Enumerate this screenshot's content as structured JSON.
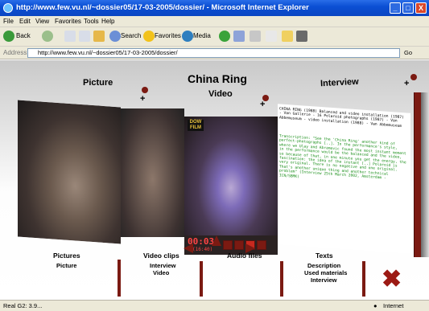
{
  "window": {
    "title": "http://www.few.vu.nl/~dossier05/17-03-2005/dossier/ - Microsoft Internet Explorer",
    "controls": {
      "minimize": "_",
      "maximize": "□",
      "close": "X"
    }
  },
  "menu": [
    "File",
    "Edit",
    "View",
    "Favorites",
    "Tools",
    "Help"
  ],
  "toolbar": {
    "back": "Back",
    "search": "Search",
    "favorites": "Favorites",
    "media": "Media"
  },
  "address": {
    "label": "Address",
    "url": "http://www.few.vu.nl/~dossier05/17-03-2005/dossier/",
    "go": "Go"
  },
  "page": {
    "title": "China Ring",
    "headings": {
      "picture": "Picture",
      "video": "Video",
      "interview": "Interview"
    },
    "plus": "+",
    "video_logo_top": "DOW",
    "video_logo_bottom": "FILM",
    "timecode": "00:03",
    "duration": "(16:40)",
    "text_red": "CHINA RING (1988) Balanced and video installation (1987) - Van Gallerie - 16 Polaroid photographs (1987) - Van Abbemuseum - video installation (1988) - Van Abbemuseum",
    "text_green": "Transcription: \"See the 'China Ring' another kind of perfect-photographs [..]. In the performance's style, where we Ulay and Abramovic found the most instant moment in the performance would be the balanced and the video, so because of that, in one minute you get the energy, the fascination: the idea of the instant [..] Polaroid is very original. There is no negative and one original. That's another unique thing and another technical problem\" (Interview 25th March 2002, Amsterdam - ICN/SBMK)"
  },
  "bottom_nav": {
    "pictures": {
      "heading": "Pictures",
      "items": [
        "Picture"
      ]
    },
    "video_clips": {
      "heading": "Video clips",
      "items": [
        "Interview",
        "Video"
      ]
    },
    "audio_files": {
      "heading": "Audio files",
      "items": []
    },
    "texts": {
      "heading": "Texts",
      "items": [
        "Description",
        "Used materials",
        "Interview"
      ]
    }
  },
  "status": {
    "left": "Real G2: 3.9...",
    "zone": "Internet"
  },
  "colors": {
    "accent": "#7b1a12",
    "titlebar": "#0b4fd4",
    "green_text": "#1b8f1b"
  }
}
